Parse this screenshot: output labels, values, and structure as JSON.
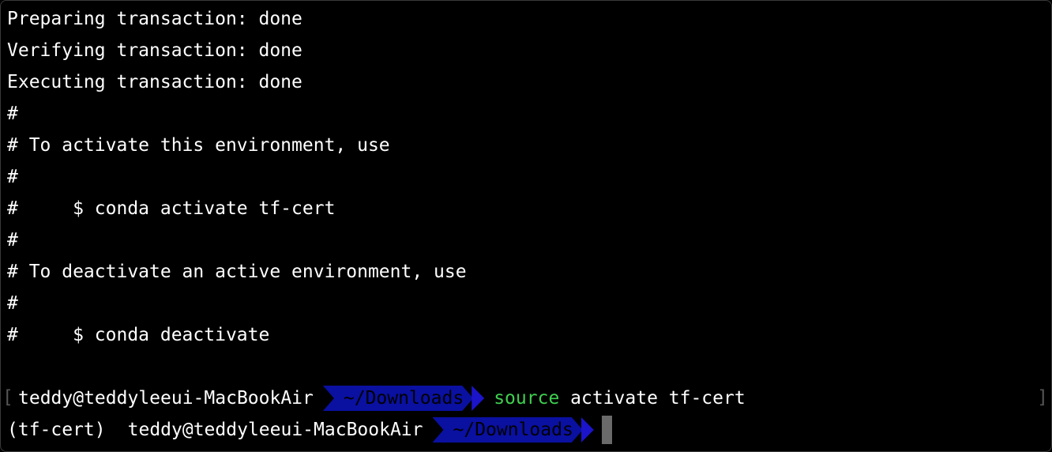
{
  "output_lines": [
    "Preparing transaction: done",
    "Verifying transaction: done",
    "Executing transaction: done",
    "#",
    "# To activate this environment, use",
    "#",
    "#     $ conda activate tf-cert",
    "#",
    "# To deactivate an active environment, use",
    "#",
    "#     $ conda deactivate"
  ],
  "prompt1": {
    "bracket_left": "[",
    "bracket_right": "]",
    "user_host": "teddy@teddyleeui-MacBookAir",
    "dir": "~/Downloads",
    "cmd_keyword": "source",
    "cmd_args": " activate tf-cert"
  },
  "prompt2": {
    "env": "(tf-cert)",
    "user_host": "teddy@teddyleeui-MacBookAir",
    "dir": "~/Downloads"
  },
  "colors": {
    "background": "#000000",
    "text": "#ffffff",
    "dir_segment": "#0a10a0",
    "command_keyword": "#3fcf50",
    "cursor": "#6a6a6a"
  }
}
